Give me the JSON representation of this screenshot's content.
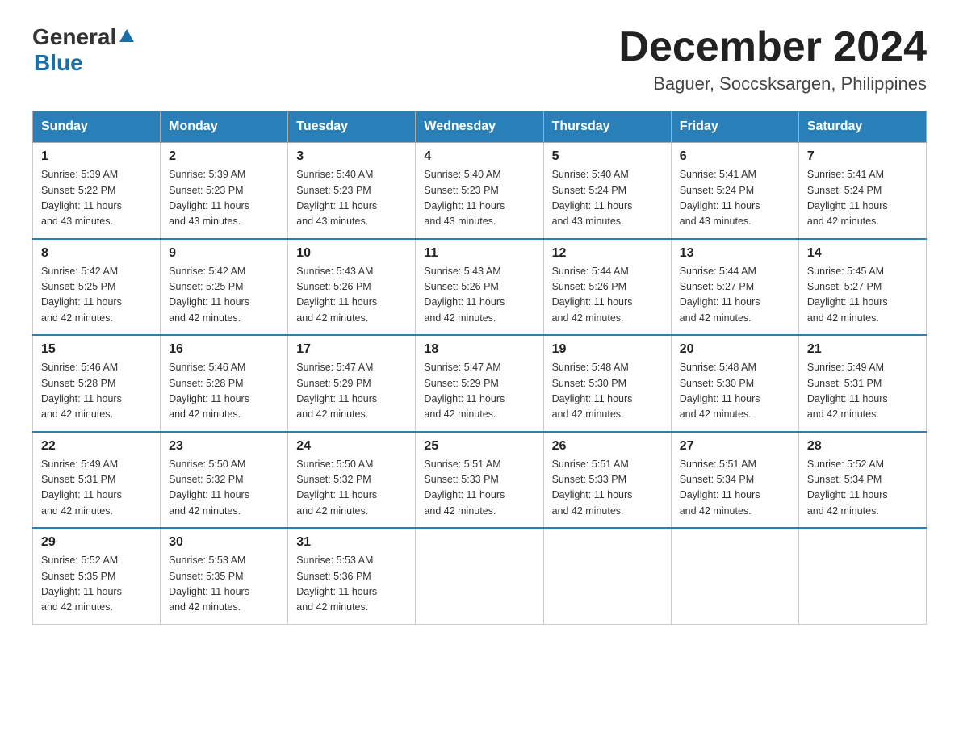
{
  "header": {
    "logo_general": "General",
    "logo_blue": "Blue",
    "month_title": "December 2024",
    "location": "Baguer, Soccsksargen, Philippines"
  },
  "weekdays": [
    "Sunday",
    "Monday",
    "Tuesday",
    "Wednesday",
    "Thursday",
    "Friday",
    "Saturday"
  ],
  "weeks": [
    [
      {
        "day": "1",
        "sunrise": "5:39 AM",
        "sunset": "5:22 PM",
        "daylight": "11 hours and 43 minutes."
      },
      {
        "day": "2",
        "sunrise": "5:39 AM",
        "sunset": "5:23 PM",
        "daylight": "11 hours and 43 minutes."
      },
      {
        "day": "3",
        "sunrise": "5:40 AM",
        "sunset": "5:23 PM",
        "daylight": "11 hours and 43 minutes."
      },
      {
        "day": "4",
        "sunrise": "5:40 AM",
        "sunset": "5:23 PM",
        "daylight": "11 hours and 43 minutes."
      },
      {
        "day": "5",
        "sunrise": "5:40 AM",
        "sunset": "5:24 PM",
        "daylight": "11 hours and 43 minutes."
      },
      {
        "day": "6",
        "sunrise": "5:41 AM",
        "sunset": "5:24 PM",
        "daylight": "11 hours and 43 minutes."
      },
      {
        "day": "7",
        "sunrise": "5:41 AM",
        "sunset": "5:24 PM",
        "daylight": "11 hours and 42 minutes."
      }
    ],
    [
      {
        "day": "8",
        "sunrise": "5:42 AM",
        "sunset": "5:25 PM",
        "daylight": "11 hours and 42 minutes."
      },
      {
        "day": "9",
        "sunrise": "5:42 AM",
        "sunset": "5:25 PM",
        "daylight": "11 hours and 42 minutes."
      },
      {
        "day": "10",
        "sunrise": "5:43 AM",
        "sunset": "5:26 PM",
        "daylight": "11 hours and 42 minutes."
      },
      {
        "day": "11",
        "sunrise": "5:43 AM",
        "sunset": "5:26 PM",
        "daylight": "11 hours and 42 minutes."
      },
      {
        "day": "12",
        "sunrise": "5:44 AM",
        "sunset": "5:26 PM",
        "daylight": "11 hours and 42 minutes."
      },
      {
        "day": "13",
        "sunrise": "5:44 AM",
        "sunset": "5:27 PM",
        "daylight": "11 hours and 42 minutes."
      },
      {
        "day": "14",
        "sunrise": "5:45 AM",
        "sunset": "5:27 PM",
        "daylight": "11 hours and 42 minutes."
      }
    ],
    [
      {
        "day": "15",
        "sunrise": "5:46 AM",
        "sunset": "5:28 PM",
        "daylight": "11 hours and 42 minutes."
      },
      {
        "day": "16",
        "sunrise": "5:46 AM",
        "sunset": "5:28 PM",
        "daylight": "11 hours and 42 minutes."
      },
      {
        "day": "17",
        "sunrise": "5:47 AM",
        "sunset": "5:29 PM",
        "daylight": "11 hours and 42 minutes."
      },
      {
        "day": "18",
        "sunrise": "5:47 AM",
        "sunset": "5:29 PM",
        "daylight": "11 hours and 42 minutes."
      },
      {
        "day": "19",
        "sunrise": "5:48 AM",
        "sunset": "5:30 PM",
        "daylight": "11 hours and 42 minutes."
      },
      {
        "day": "20",
        "sunrise": "5:48 AM",
        "sunset": "5:30 PM",
        "daylight": "11 hours and 42 minutes."
      },
      {
        "day": "21",
        "sunrise": "5:49 AM",
        "sunset": "5:31 PM",
        "daylight": "11 hours and 42 minutes."
      }
    ],
    [
      {
        "day": "22",
        "sunrise": "5:49 AM",
        "sunset": "5:31 PM",
        "daylight": "11 hours and 42 minutes."
      },
      {
        "day": "23",
        "sunrise": "5:50 AM",
        "sunset": "5:32 PM",
        "daylight": "11 hours and 42 minutes."
      },
      {
        "day": "24",
        "sunrise": "5:50 AM",
        "sunset": "5:32 PM",
        "daylight": "11 hours and 42 minutes."
      },
      {
        "day": "25",
        "sunrise": "5:51 AM",
        "sunset": "5:33 PM",
        "daylight": "11 hours and 42 minutes."
      },
      {
        "day": "26",
        "sunrise": "5:51 AM",
        "sunset": "5:33 PM",
        "daylight": "11 hours and 42 minutes."
      },
      {
        "day": "27",
        "sunrise": "5:51 AM",
        "sunset": "5:34 PM",
        "daylight": "11 hours and 42 minutes."
      },
      {
        "day": "28",
        "sunrise": "5:52 AM",
        "sunset": "5:34 PM",
        "daylight": "11 hours and 42 minutes."
      }
    ],
    [
      {
        "day": "29",
        "sunrise": "5:52 AM",
        "sunset": "5:35 PM",
        "daylight": "11 hours and 42 minutes."
      },
      {
        "day": "30",
        "sunrise": "5:53 AM",
        "sunset": "5:35 PM",
        "daylight": "11 hours and 42 minutes."
      },
      {
        "day": "31",
        "sunrise": "5:53 AM",
        "sunset": "5:36 PM",
        "daylight": "11 hours and 42 minutes."
      },
      null,
      null,
      null,
      null
    ]
  ],
  "labels": {
    "sunrise": "Sunrise:",
    "sunset": "Sunset:",
    "daylight": "Daylight:"
  }
}
